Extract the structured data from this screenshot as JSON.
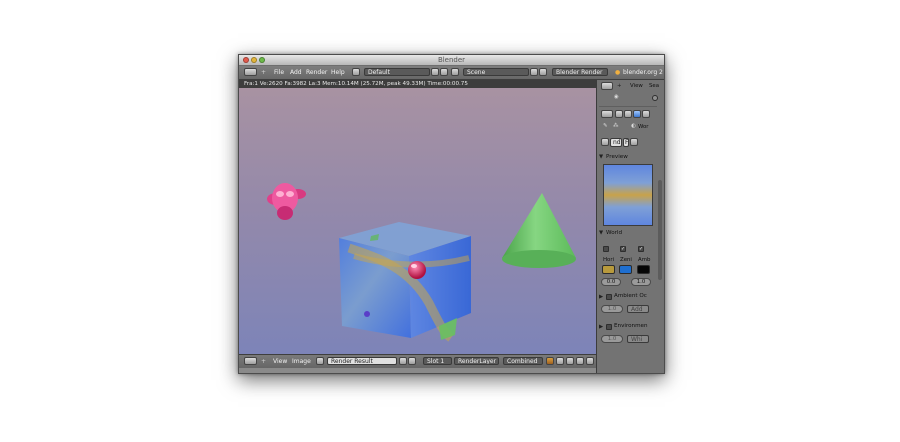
{
  "window": {
    "title": "Blender"
  },
  "header": {
    "menus": [
      "File",
      "Add",
      "Render",
      "Help"
    ],
    "screen_layout": "Default",
    "scene": "Scene",
    "render_engine": "Blender Render",
    "site_link": "blender.org 2"
  },
  "info_bar": {
    "text": "Fra:1  Ve:2620 Fa:3982 La:3 Mem:10.14M (25.72M, peak 49.33M) Time:00:00.75"
  },
  "bottom_bar": {
    "view": "View",
    "image": "Image",
    "image_name": "Render Result",
    "slot": "Slot 1",
    "layer": "RenderLayer",
    "pass": "Combined"
  },
  "properties": {
    "outliner_view": "View",
    "outliner_search": "Sea",
    "context_label": "Wor",
    "world_name": "nd",
    "world_user_count": "F",
    "preview_panel": "Preview",
    "world_panel": "World",
    "color_labels": [
      "Hori",
      "Zeni",
      "Amb"
    ],
    "colors": {
      "horizon": "#b89a3c",
      "zenith": "#1f6fd0",
      "ambient": "#050505"
    },
    "fields": [
      "0.0",
      "1.0"
    ],
    "ambient_occlusion_panel": "Ambient Oc",
    "ao_factor": "1.0",
    "ao_mode": "Add",
    "environment_panel": "Environmen",
    "env_energy": "1.0",
    "env_color_mode": "Whi"
  },
  "render_scene": {
    "background_top": "#a892a2",
    "background_bottom": "#7d84b8",
    "objects": [
      "monkey-head",
      "cube",
      "cone",
      "sphere"
    ]
  }
}
